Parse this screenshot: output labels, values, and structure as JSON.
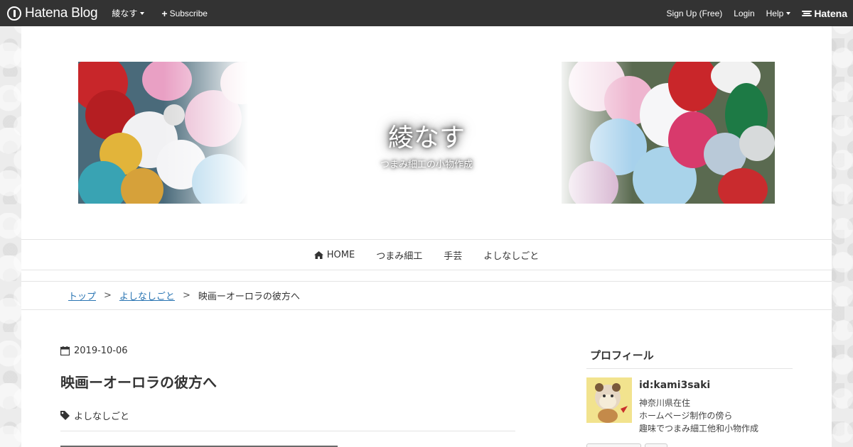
{
  "global_header": {
    "logo_label": "Hatena Blog",
    "blog_name": "綾なす",
    "subscribe_label": "Subscribe",
    "signup_label": "Sign Up (Free)",
    "login_label": "Login",
    "help_label": "Help",
    "hatena_label": "Hatena"
  },
  "blog": {
    "title": "綾なす",
    "description": "つまみ細工の小物作成"
  },
  "nav": {
    "items": [
      {
        "label": "HOME",
        "icon": "home-icon"
      },
      {
        "label": "つまみ細工"
      },
      {
        "label": "手芸"
      },
      {
        "label": "よしなしごと"
      }
    ]
  },
  "breadcrumb": {
    "items": [
      "トップ",
      "よしなしごと"
    ],
    "separator": ">",
    "current": "映画ーオーロラの彼方へ"
  },
  "entry": {
    "date": "2019-10-06",
    "title": "映画ーオーロラの彼方へ",
    "category": "よしなしごと"
  },
  "sidebar": {
    "profile_heading": "プロフィール",
    "profile_id": "id:kami3saki",
    "profile_lines": [
      "神奈川県在住",
      "ホームページ制作の傍ら",
      "趣味でつまみ細工他和小物作成"
    ]
  },
  "colors": {
    "topbar": "#333333",
    "link": "#2a75b3",
    "text": "#333333"
  }
}
